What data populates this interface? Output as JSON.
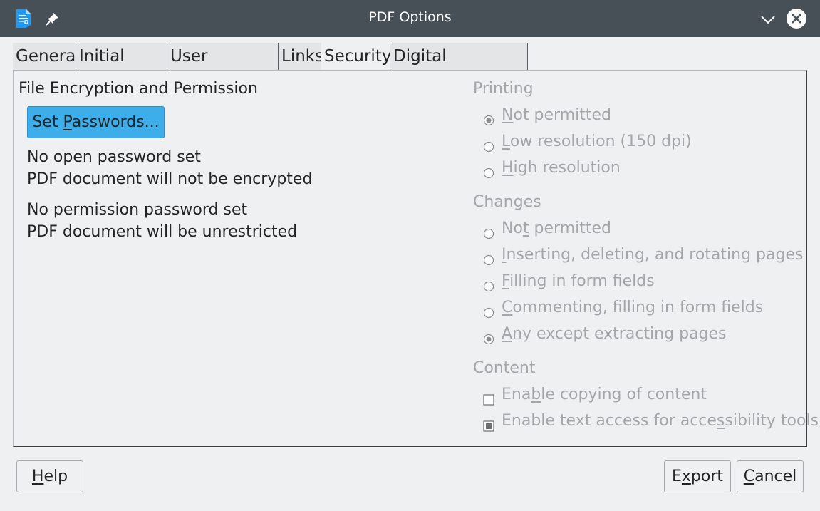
{
  "window": {
    "title": "PDF Options"
  },
  "tabs": [
    {
      "label": "General"
    },
    {
      "label": "Initial View"
    },
    {
      "label": "User Interface"
    },
    {
      "label": "Links"
    },
    {
      "label": "Security"
    },
    {
      "label": "Digital Signatures"
    }
  ],
  "security": {
    "encryption_heading": "File Encryption and Permission",
    "set_passwords": {
      "pre": "Set ",
      "mnemonic": "P",
      "post": "asswords..."
    },
    "open_status": "No open password set",
    "encrypt_status": "PDF document will not be encrypted",
    "perm_status": "No permission password set",
    "restrict_status": "PDF document will be unrestricted"
  },
  "printing": {
    "heading": "Printing",
    "options": [
      {
        "pre": "",
        "mn": "N",
        "post": "ot permitted",
        "selected": true
      },
      {
        "pre": "",
        "mn": "L",
        "post": "ow resolution (150 dpi)",
        "selected": false
      },
      {
        "pre": "",
        "mn": "H",
        "post": "igh resolution",
        "selected": false
      }
    ]
  },
  "changes": {
    "heading": "Changes",
    "options": [
      {
        "pre": "No",
        "mn": "t",
        "post": " permitted",
        "selected": false
      },
      {
        "pre": "",
        "mn": "I",
        "post": "nserting, deleting, and rotating pages",
        "selected": false
      },
      {
        "pre": "",
        "mn": "F",
        "post": "illing in form fields",
        "selected": false
      },
      {
        "pre": "",
        "mn": "C",
        "post": "ommenting, filling in form fields",
        "selected": false
      },
      {
        "pre": "",
        "mn": "A",
        "post": "ny except extracting pages",
        "selected": true
      }
    ]
  },
  "content": {
    "heading": "Content",
    "options": [
      {
        "pre": "Ena",
        "mn": "b",
        "post": "le copying of content",
        "checked": false
      },
      {
        "pre": "Enable text access for acce",
        "mn": "s",
        "post": "sibility tools",
        "checked": true
      }
    ]
  },
  "buttons": {
    "help": {
      "pre": "",
      "mn": "H",
      "post": "elp"
    },
    "export": {
      "pre": "E",
      "mn": "x",
      "post": "port"
    },
    "cancel": {
      "pre": "",
      "mn": "C",
      "post": "ancel"
    }
  }
}
